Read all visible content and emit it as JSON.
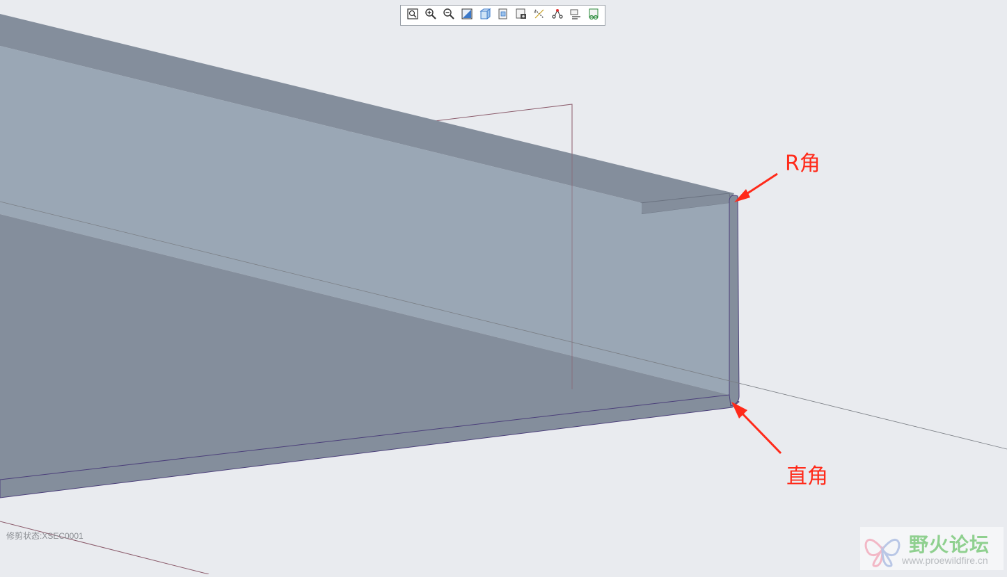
{
  "toolbar": {
    "buttons": [
      {
        "name": "refit-icon"
      },
      {
        "name": "zoom-in-icon"
      },
      {
        "name": "zoom-out-icon"
      },
      {
        "name": "repaint-icon"
      },
      {
        "name": "display-style-icon"
      },
      {
        "name": "saved-orientations-icon"
      },
      {
        "name": "view-manager-icon"
      },
      {
        "name": "datum-display-icon"
      },
      {
        "name": "annotation-display-icon"
      },
      {
        "name": "section-display-icon"
      },
      {
        "name": "spin-center-icon"
      }
    ]
  },
  "annotations": {
    "top_label": "R角",
    "bottom_label": "直角"
  },
  "status": {
    "text": "修剪状态:XSEC0001"
  },
  "watermark": {
    "title": "野火论坛",
    "url": "www.proewildfire.cn"
  },
  "colors": {
    "background": "#e9ebef",
    "part_face": "#9aa7b5",
    "part_edge": "#848e9c",
    "annotation": "#ff2a1a",
    "datum_plane": "#8a5a6a"
  }
}
